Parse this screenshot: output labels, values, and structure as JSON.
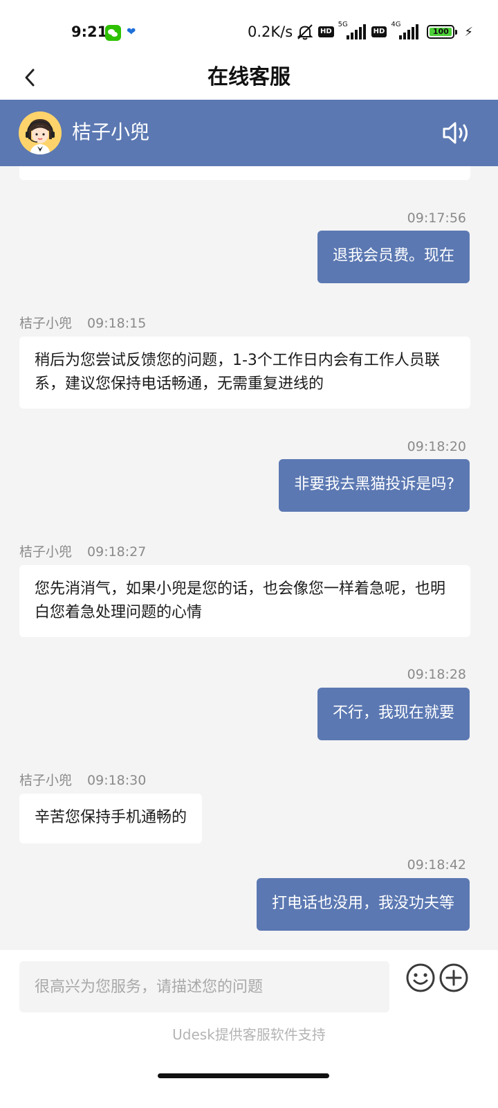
{
  "status_bar": {
    "time": "9:21",
    "speed": "0.2K/s",
    "hd_badge": "HD",
    "net1": "5G",
    "net2": "4G",
    "battery": "100",
    "icons": [
      "wechat-icon",
      "bird-notification-icon",
      "mute-bell-icon",
      "hd-icon",
      "signal-5g-icon",
      "hd-icon",
      "signal-4g-icon",
      "battery-icon",
      "charging-bolt-icon"
    ]
  },
  "nav": {
    "title": "在线客服",
    "back_icon": "chevron-left-icon"
  },
  "agent": {
    "name": "桔子小兜",
    "speaker_icon": "speaker-icon"
  },
  "messages": [
    {
      "direction": "out",
      "time": "09:17:56",
      "text": "退我会员费。现在"
    },
    {
      "direction": "in",
      "sender": "桔子小兜",
      "time": "09:18:15",
      "text": "稍后为您尝试反馈您的问题，1-3个工作日内会有工作人员联系，建议您保持电话畅通，无需重复进线的"
    },
    {
      "direction": "out",
      "time": "09:18:20",
      "text": "非要我去黑猫投诉是吗?"
    },
    {
      "direction": "in",
      "sender": "桔子小兜",
      "time": "09:18:27",
      "text": "您先消消气，如果小兜是您的话，也会像您一样着急呢，也明白您着急处理问题的心情"
    },
    {
      "direction": "out",
      "time": "09:18:28",
      "text": "不行，我现在就要"
    },
    {
      "direction": "in",
      "sender": "桔子小兜",
      "time": "09:18:30",
      "text": "辛苦您保持手机通畅的"
    },
    {
      "direction": "out",
      "time": "09:18:42",
      "text": "打电话也没用，我没功夫等"
    }
  ],
  "composer": {
    "placeholder": "很高兴为您服务，请描述您的问题",
    "emoji_icon": "emoji-icon",
    "plus_icon": "plus-icon",
    "powered_by": "Udesk提供客服软件支持"
  },
  "colors": {
    "accent": "#5b78b2",
    "background": "#f4f4f5",
    "bubble_in": "#ffffff",
    "meta_text": "#8a8a8a"
  }
}
